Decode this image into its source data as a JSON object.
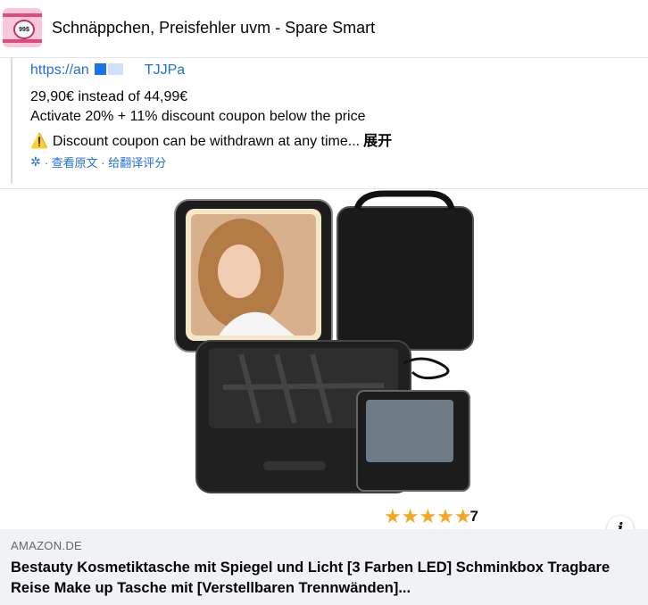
{
  "header": {
    "group_name": "Schnäppchen, Preisfehler uvm - Spare Smart",
    "avatar_badge": "99$"
  },
  "post": {
    "link_prefix": "https://an",
    "link_suffix": "TJJPa",
    "price_line": "29,90€ instead of 44,99€",
    "discount_line": "Activate 20% + 11% discount coupon below the price",
    "warning_icon": "⚠️",
    "warning_line": "Discount coupon can be withdrawn at any time...",
    "expand_label": "展开",
    "translate": {
      "icon": "gear-icon",
      "label": "· 查看原文 · 给翻译评分"
    }
  },
  "product_image": {
    "rating_count": "7",
    "stars": 5
  },
  "link_card": {
    "domain": "AMAZON.DE",
    "title": "Bestauty Kosmetiktasche mit Spiegel und Licht [3 Farben LED] Schminkbox Tragbare Reise Make up Tasche mit [Verstellbaren Trennwänden]..."
  },
  "info_button": {
    "label": "i"
  },
  "colors": {
    "link": "#216fdb",
    "card_bg": "#f0f2f5",
    "muted": "#65676b",
    "star": "#f5a623"
  }
}
